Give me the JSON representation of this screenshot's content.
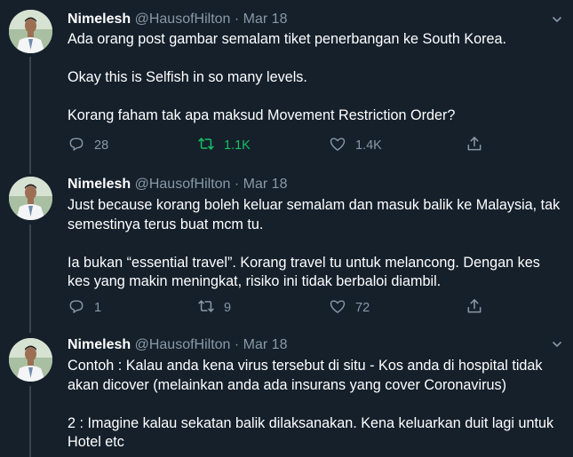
{
  "tweets": [
    {
      "name": "Nimelesh",
      "handle": "@HausofHilton",
      "dot": "·",
      "date": "Mar 18",
      "paragraphs": [
        "Ada orang post gambar semalam tiket penerbangan ke South Korea.",
        "Okay this is Selfish in so many levels.",
        "Korang faham tak apa maksud Movement Restriction Order?"
      ],
      "replies": "28",
      "retweets": "1.1K",
      "likes": "1.4K",
      "retweeted": true
    },
    {
      "name": "Nimelesh",
      "handle": "@HausofHilton",
      "dot": "·",
      "date": "Mar 18",
      "paragraphs": [
        "Just because korang boleh keluar semalam dan masuk balik ke Malaysia, tak semestinya terus buat mcm tu.",
        "Ia bukan “essential travel”. Korang travel tu untuk melancong. Dengan kes kes yang makin meningkat, risiko ini tidak berbaloi diambil."
      ],
      "replies": "1",
      "retweets": "9",
      "likes": "72",
      "retweeted": false
    },
    {
      "name": "Nimelesh",
      "handle": "@HausofHilton",
      "dot": "·",
      "date": "Mar 18",
      "paragraphs": [
        "Contoh : Kalau anda kena virus tersebut di situ - Kos anda di hospital tidak akan dicover (melainkan anda ada insurans yang cover Coronavirus)",
        "2 : Imagine kalau sekatan balik dilaksanakan. Kena keluarkan duit lagi untuk Hotel etc"
      ]
    }
  ],
  "colors": {
    "background": "#15202b",
    "muted": "#8899a6",
    "retweet_active": "#17bf63",
    "divider": "#38444d"
  },
  "icons": [
    "reply-icon",
    "retweet-icon",
    "like-icon",
    "share-icon",
    "chevron-down-icon",
    "avatar"
  ]
}
